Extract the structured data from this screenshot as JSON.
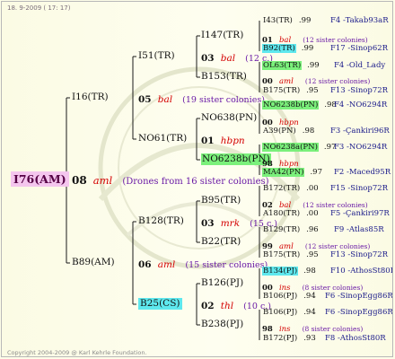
{
  "header": {
    "date_stamp": "18.  9-2009 ( 17: 17)",
    "copyright": "Copyright 2004-2009 @ Karl Kehrle Foundation."
  },
  "root": {
    "code": "I76(AM)",
    "gen": "08",
    "year": "aml",
    "note": "(Drones from 16 sister colonies)"
  },
  "level1": [
    {
      "code": "I16(TR)",
      "gen": "05",
      "year": "bal",
      "note": "(19 sister colonies)"
    },
    {
      "code": "B89(AM)",
      "gen": "06",
      "year": "aml",
      "note": "(15 sister colonies)"
    }
  ],
  "level2": [
    {
      "code": "I51(TR)",
      "gen": "03",
      "year": "bal",
      "note": "(12 c.)"
    },
    {
      "code": "NO61(TR)",
      "gen": "01",
      "year": "hbpn",
      "note": ""
    },
    {
      "code": "B128(TR)",
      "gen": "03",
      "year": "mrk",
      "note": "(15 c.)"
    },
    {
      "code": "B25(CS)",
      "gen": "02",
      "year": "thl",
      "note": "(10 c.)"
    }
  ],
  "level3": [
    {
      "code": "I147(TR)",
      "gen": "01",
      "year": "bal",
      "note": "(12 sister colonies)"
    },
    {
      "code": "B153(TR)",
      "gen": "00",
      "year": "aml",
      "note": "(12 sister colonies)"
    },
    {
      "code": "NO638(PN)",
      "gen": "00",
      "year": "hbpn",
      "note": ""
    },
    {
      "code": "NO6238b(PN)",
      "gen": "98",
      "year": "hbpn",
      "note": ""
    },
    {
      "code": "B95(TR)",
      "gen": "02",
      "year": "bal",
      "note": "(12 sister colonies)"
    },
    {
      "code": "B22(TR)",
      "gen": "99",
      "year": "aml",
      "note": "(12 sister colonies)"
    },
    {
      "code": "B126(PJ)",
      "gen": "00",
      "year": "ins",
      "note": "(8 sister colonies)"
    },
    {
      "code": "B238(PJ)",
      "gen": "98",
      "year": "ins",
      "note": "(8 sister colonies)"
    }
  ],
  "leaves": [
    {
      "code": "I43(TR)",
      "score": ".99",
      "ped": "F4 -Takab93aR"
    },
    {
      "code": "B92(TR)",
      "score": ".99",
      "ped": "F17 -Sinop62R"
    },
    {
      "code": "OL63(TR)",
      "score": ".99",
      "ped": "F4 -Old_Lady"
    },
    {
      "code": "B175(TR)",
      "score": ".95",
      "ped": "F13 -Sinop72R"
    },
    {
      "code": "NO6238b(PN)",
      "score": ".98",
      "ped": "F4 -NO6294R"
    },
    {
      "code": "A39(PN)",
      "score": ".98",
      "ped": "F3 -Çankiri96R"
    },
    {
      "code": "NO6238a(PN)",
      "score": ".97",
      "ped": "F3 -NO6294R"
    },
    {
      "code": "MA42(PN)",
      "score": ".97",
      "ped": "F2 -Maced95R"
    },
    {
      "code": "B172(TR)",
      "score": ".00",
      "ped": "F15 -Sinop72R"
    },
    {
      "code": "A180(TR)",
      "score": ".00",
      "ped": "F5 -Çankiri97R"
    },
    {
      "code": "B129(TR)",
      "score": ".96",
      "ped": "F9 -Atlas85R"
    },
    {
      "code": "B175(TR)",
      "score": ".95",
      "ped": "F13 -Sinop72R"
    },
    {
      "code": "B134(PJ)",
      "score": ".98",
      "ped": "F10 -AthosSt80R"
    },
    {
      "code": "B106(PJ)",
      "score": ".94",
      "ped": "F6 -SinopEgg86R"
    },
    {
      "code": "B106(PJ)",
      "score": ".94",
      "ped": "F6 -SinopEgg86R"
    },
    {
      "code": "B172(PJ)",
      "score": ".93",
      "ped": "F8 -AthosSt80R"
    }
  ]
}
